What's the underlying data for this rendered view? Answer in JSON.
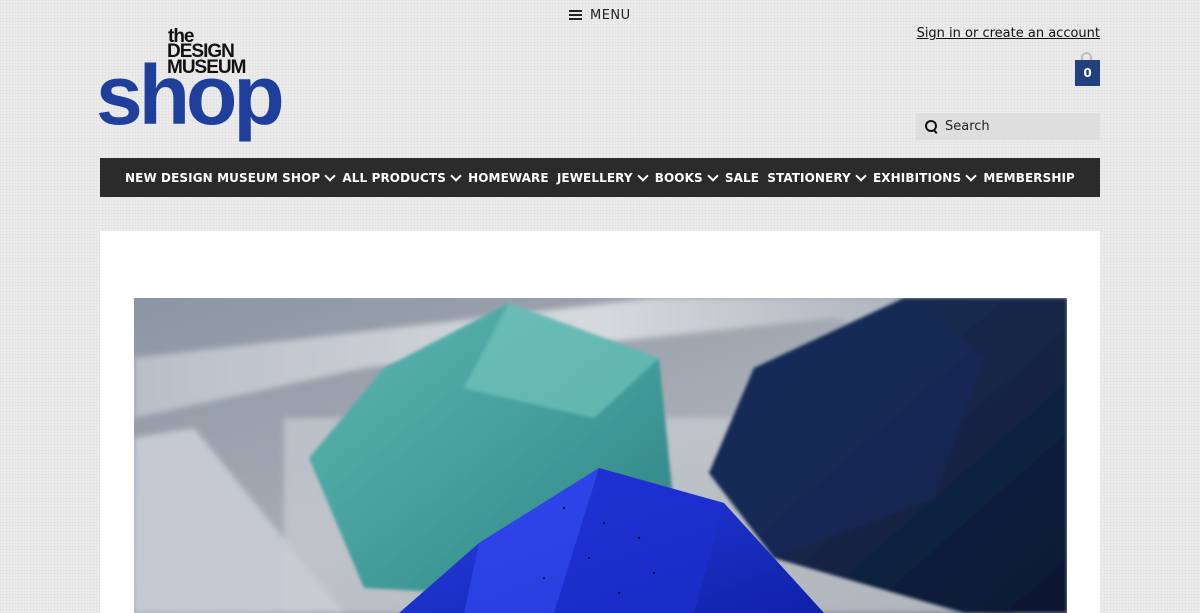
{
  "header": {
    "menu_label": "MENU",
    "logo": {
      "the": "the",
      "line1": "DESIGN",
      "line2": "MUSEUM",
      "shop": "shop"
    },
    "account_link": "Sign in or create an account",
    "cart": {
      "count": "0",
      "icon": "shopping-bag-icon"
    },
    "search": {
      "placeholder": "Search",
      "value": "",
      "icon": "search-icon"
    }
  },
  "nav": {
    "items": [
      {
        "label": "NEW DESIGN MUSEUM SHOP",
        "has_dropdown": true
      },
      {
        "label": "ALL PRODUCTS",
        "has_dropdown": true
      },
      {
        "label": "HOMEWARE",
        "has_dropdown": false
      },
      {
        "label": "JEWELLERY",
        "has_dropdown": true
      },
      {
        "label": "BOOKS",
        "has_dropdown": true
      },
      {
        "label": "SALE",
        "has_dropdown": false
      },
      {
        "label": "STATIONERY",
        "has_dropdown": true
      },
      {
        "label": "EXHIBITIONS",
        "has_dropdown": true
      },
      {
        "label": "MEMBERSHIP",
        "has_dropdown": false
      }
    ]
  },
  "colors": {
    "brand_blue": "#1f3f9c",
    "nav_background": "#2b2b2b",
    "cart_blue": "#23407e"
  }
}
